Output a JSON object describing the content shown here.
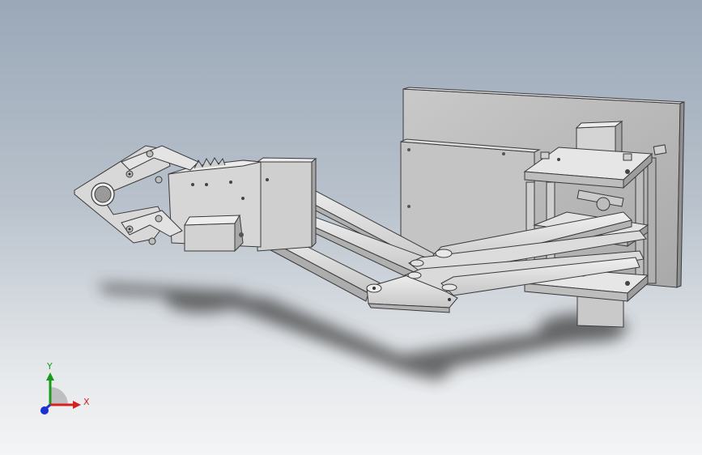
{
  "viewport": {
    "background_top": "#9aa8b8",
    "background_bottom": "#f4f5f6"
  },
  "model": {
    "part_color": "#d9d9d9",
    "part_shade": "#b5b5b5",
    "edge_color": "#3a3a3a",
    "shadow_color": "#3c3c3c"
  },
  "triad": {
    "x_label": "X",
    "y_label": "Y",
    "x_color": "#d42020",
    "y_color": "#1a9a1a",
    "z_color": "#2030d0"
  }
}
